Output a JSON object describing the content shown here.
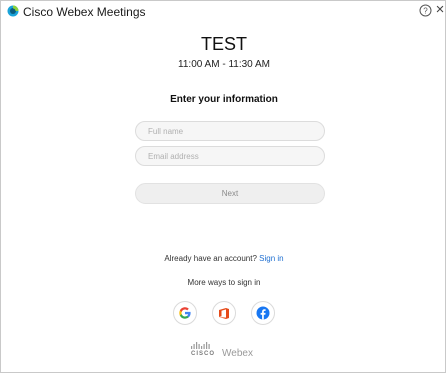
{
  "window": {
    "app_title": "Cisco Webex Meetings",
    "help_icon": "question-circle-icon",
    "close_label": "×"
  },
  "meeting": {
    "title": "TEST",
    "time": "11:00 AM - 11:30 AM"
  },
  "form": {
    "heading": "Enter your information",
    "name_placeholder": "Full name",
    "email_placeholder": "Email address",
    "next_label": "Next"
  },
  "account": {
    "prompt": "Already have an account?",
    "sign_in_label": "Sign in",
    "more_ways": "More ways to sign in"
  },
  "social": [
    {
      "name": "google",
      "icon": "google-icon",
      "color": "#4285F4"
    },
    {
      "name": "office",
      "icon": "office-icon",
      "color": "#E64A19"
    },
    {
      "name": "facebook",
      "icon": "facebook-icon",
      "color": "#1877F2"
    }
  ],
  "footer": {
    "brand_cisco": "CISCO",
    "brand_product": "Webex"
  },
  "colors": {
    "link": "#1f6fd1",
    "brand_gray": "#9a9a9a"
  }
}
